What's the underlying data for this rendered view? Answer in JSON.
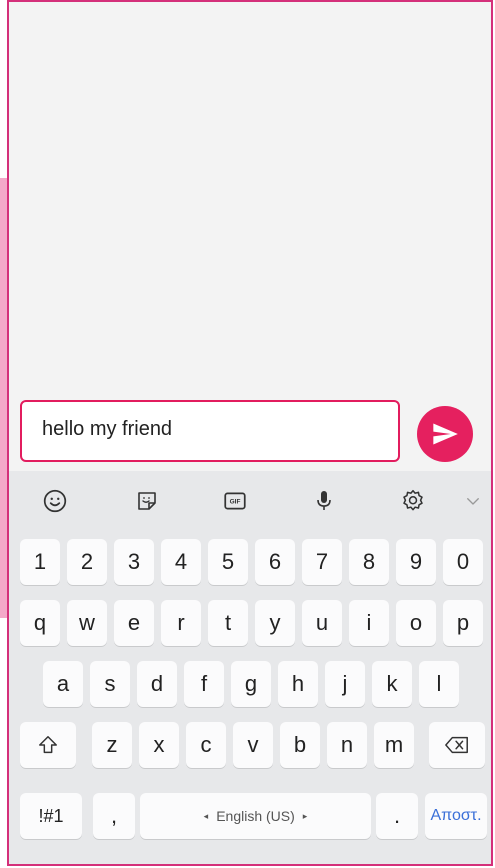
{
  "chat": {
    "message_value": "hello my friend"
  },
  "icons": {
    "send": "send-icon",
    "emoji": "emoji-icon",
    "sticker": "sticker-icon",
    "gif": "gif-icon",
    "mic": "microphone-icon",
    "settings": "gear-icon",
    "collapse": "chevron-down-icon",
    "shift": "shift-icon",
    "backspace": "backspace-icon"
  },
  "toolbar": {
    "gif_label": "GIF"
  },
  "keyboard": {
    "row_numbers": [
      "1",
      "2",
      "3",
      "4",
      "5",
      "6",
      "7",
      "8",
      "9",
      "0"
    ],
    "row_q": [
      "q",
      "w",
      "e",
      "r",
      "t",
      "y",
      "u",
      "i",
      "o",
      "p"
    ],
    "row_a": [
      "a",
      "s",
      "d",
      "f",
      "g",
      "h",
      "j",
      "k",
      "l"
    ],
    "row_z": [
      "z",
      "x",
      "c",
      "v",
      "b",
      "n",
      "m"
    ],
    "symbols_label": "!#1",
    "comma_label": ",",
    "space_label": "English (US)",
    "period_label": ".",
    "enter_label": "Αποστ."
  },
  "colors": {
    "accent": "#e5205f",
    "frame": "#d4307a",
    "keyboard_bg": "#e7e8ea",
    "key_bg": "#fbfbfc"
  }
}
